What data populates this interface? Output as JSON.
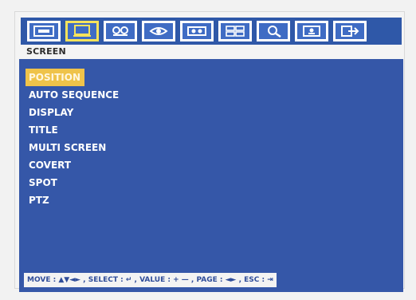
{
  "toolbar": {
    "icons": [
      {
        "name": "camera-setup-icon",
        "active": false
      },
      {
        "name": "screen-icon",
        "active": true
      },
      {
        "name": "record-icon",
        "active": false
      },
      {
        "name": "event-icon",
        "active": false
      },
      {
        "name": "device-icon",
        "active": false
      },
      {
        "name": "network-icon",
        "active": false
      },
      {
        "name": "system-icon",
        "active": false
      },
      {
        "name": "user-icon",
        "active": false
      },
      {
        "name": "exit-icon",
        "active": false
      }
    ]
  },
  "section": {
    "title": "SCREEN"
  },
  "menu": {
    "items": [
      "POSITION",
      "AUTO SEQUENCE",
      "DISPLAY",
      "TITLE",
      "MULTI SCREEN",
      "COVERT",
      "SPOT",
      "PTZ"
    ],
    "selected_index": 0
  },
  "hint": {
    "text": "MOVE : ▲▼◄► , SELECT : ↵ , VALUE : + — , PAGE : ◄► , ESC : ⇥"
  },
  "colors": {
    "toolbar_bg": "#2f58a8",
    "panel_bg": "#3557a8",
    "selected_bg": "#efc34a",
    "hint_text": "#2f4d9a"
  }
}
